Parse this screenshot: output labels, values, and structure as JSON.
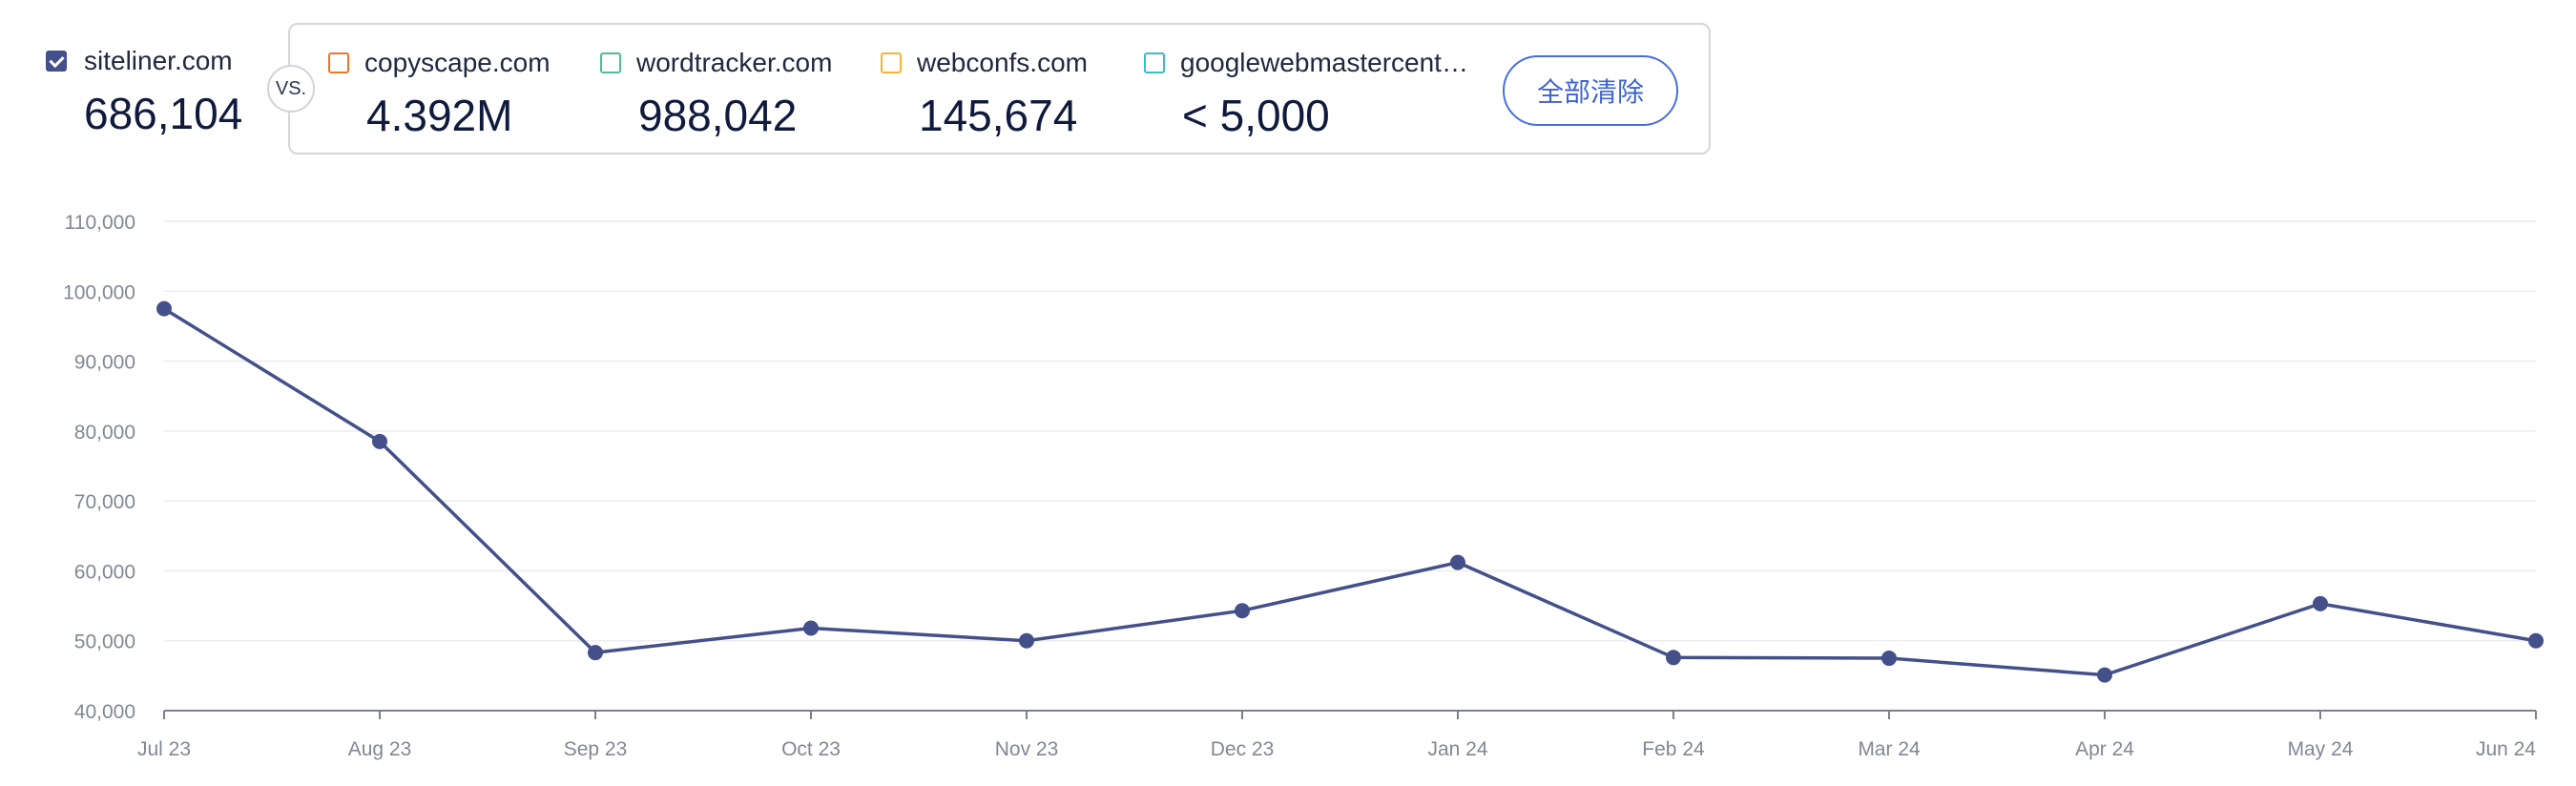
{
  "header": {
    "primary": {
      "domain": "siteliner.com",
      "value": "686,104",
      "checked": true,
      "color": "#43508a"
    },
    "vs_label": "VS.",
    "competitors": [
      {
        "domain": "copyscape.com",
        "value": "4.392M",
        "color": "#e8762b",
        "checked": false
      },
      {
        "domain": "wordtracker.com",
        "value": "988,042",
        "color": "#4fbf8f",
        "checked": false
      },
      {
        "domain": "webconfs.com",
        "value": "145,674",
        "color": "#f5b335",
        "checked": false
      },
      {
        "domain": "googlewebmastercent…",
        "value": "< 5,000",
        "color": "#3fb8c9",
        "checked": false
      }
    ],
    "clear_all_label": "全部清除"
  },
  "chart_data": {
    "type": "line",
    "categories": [
      "Jul 23",
      "Aug 23",
      "Sep 23",
      "Oct 23",
      "Nov 23",
      "Dec 23",
      "Jan 24",
      "Feb 24",
      "Mar 24",
      "Apr 24",
      "May 24",
      "Jun 24"
    ],
    "series": [
      {
        "values": [
          97500,
          78500,
          48300,
          51800,
          50000,
          54300,
          61200,
          47600,
          47500,
          45100,
          55300,
          50000
        ],
        "color": "#43508a"
      }
    ],
    "ylim": [
      40000,
      110000
    ],
    "yticks": [
      40000,
      50000,
      60000,
      70000,
      80000,
      90000,
      100000,
      110000
    ],
    "ytick_labels": [
      "40,000",
      "50,000",
      "60,000",
      "70,000",
      "80,000",
      "90,000",
      "100,000",
      "110,000"
    ],
    "grid": true,
    "title": "",
    "xlabel": "",
    "ylabel": ""
  }
}
